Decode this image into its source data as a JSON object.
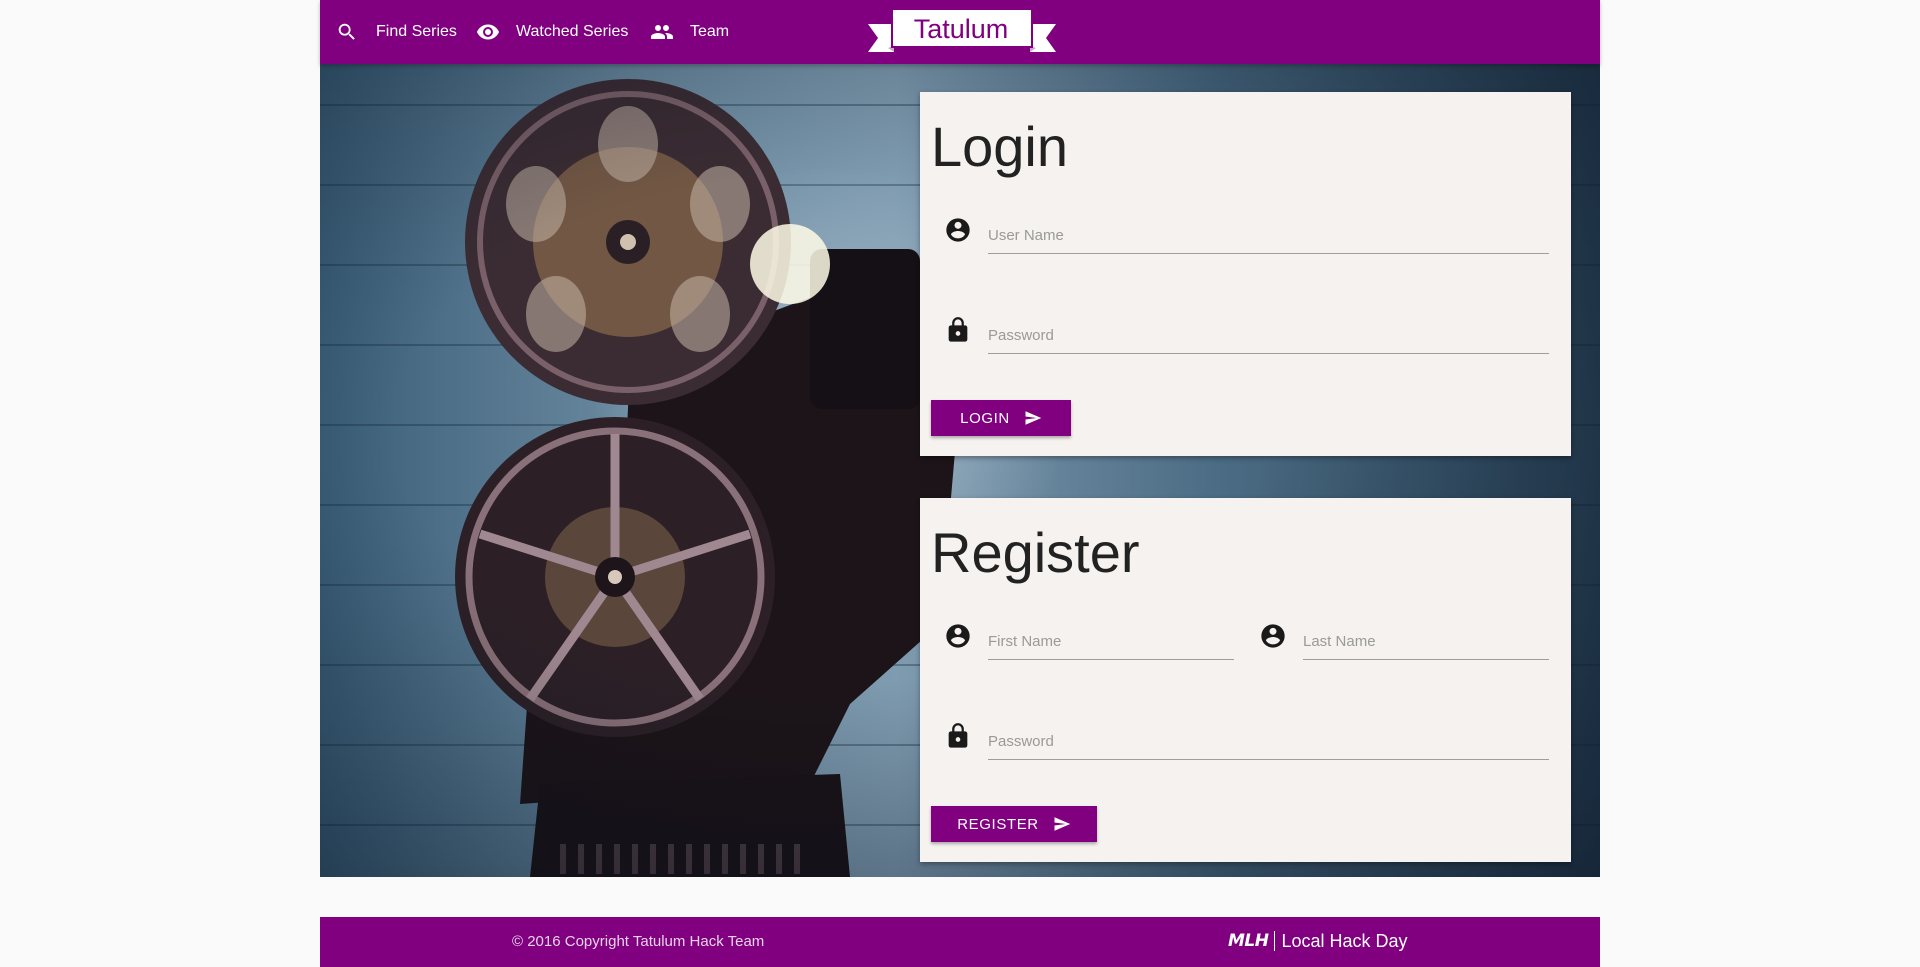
{
  "nav": {
    "items": [
      {
        "label": "Find Series",
        "icon": "search-icon"
      },
      {
        "label": "Watched Series",
        "icon": "eye-icon"
      },
      {
        "label": "Team",
        "icon": "people-icon"
      }
    ],
    "brand": "Tatulum"
  },
  "login": {
    "title": "Login",
    "username_placeholder": "User Name",
    "password_placeholder": "Password",
    "button_label": "LOGIN"
  },
  "register": {
    "title": "Register",
    "first_name_placeholder": "First Name",
    "last_name_placeholder": "Last Name",
    "password_placeholder": "Password",
    "button_label": "REGISTER"
  },
  "footer": {
    "copyright": "© 2016 Copyright Tatulum Hack Team",
    "mlh_logo": "MLH",
    "mlh_text": "Local Hack Day"
  },
  "colors": {
    "primary": "#800080",
    "card_bg": "#f5f2ef"
  }
}
